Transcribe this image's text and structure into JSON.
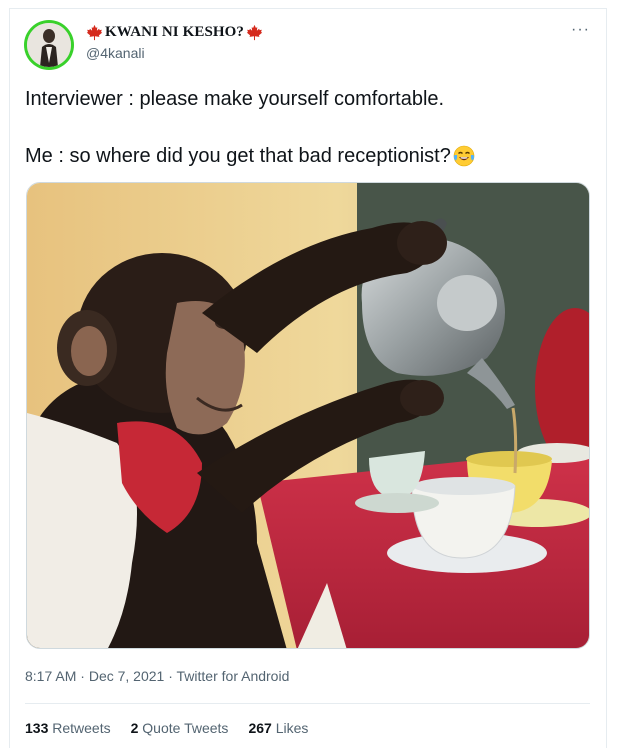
{
  "tweet": {
    "display_name": "KWANI NI KESHO?",
    "handle": "@4kanali",
    "more_label": "···",
    "text_line1": "Interviewer : please make yourself comfortable.",
    "text_line2": "Me : so where did you get that bad receptionist?",
    "time": "8:17 AM",
    "separator": "·",
    "date": "Dec 7, 2021",
    "source": "Twitter for Android"
  },
  "stats": [
    {
      "count": "133",
      "label": "Retweets"
    },
    {
      "count": "2",
      "label": "Quote Tweets"
    },
    {
      "count": "267",
      "label": "Likes"
    }
  ],
  "icons": {
    "name_prefix": "maple-leaf-icon",
    "name_suffix": "maple-leaf-icon",
    "emoji": "tears-of-joy-emoji-icon",
    "more": "more-options-icon"
  },
  "colors": {
    "avatar_ring": "#39d12b",
    "maple_leaf": "#d52b1e",
    "secondary_text": "#536471",
    "primary_text": "#0f1419"
  }
}
